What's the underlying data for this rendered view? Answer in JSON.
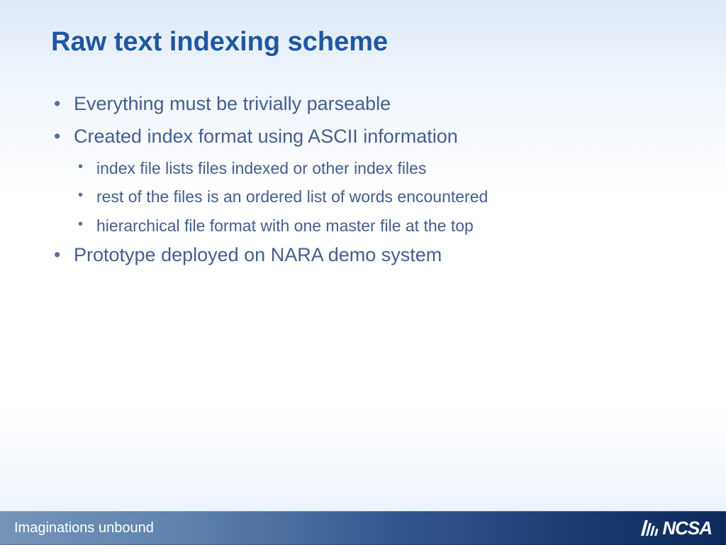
{
  "title": "Raw text indexing scheme",
  "bullets": [
    {
      "level": 1,
      "text": "Everything must be trivially parseable"
    },
    {
      "level": 1,
      "text": "Created index format using ASCII information"
    },
    {
      "level": 2,
      "text": "index file lists files indexed or other index files"
    },
    {
      "level": 2,
      "text": "rest of the files is an ordered list of words encountered"
    },
    {
      "level": 2,
      "text": "hierarchical file format with one master file at the top"
    },
    {
      "level": 1,
      "text": "Prototype deployed on NARA demo system"
    }
  ],
  "footer": {
    "tagline": "Imaginations unbound",
    "logo_text": "NCSA"
  }
}
